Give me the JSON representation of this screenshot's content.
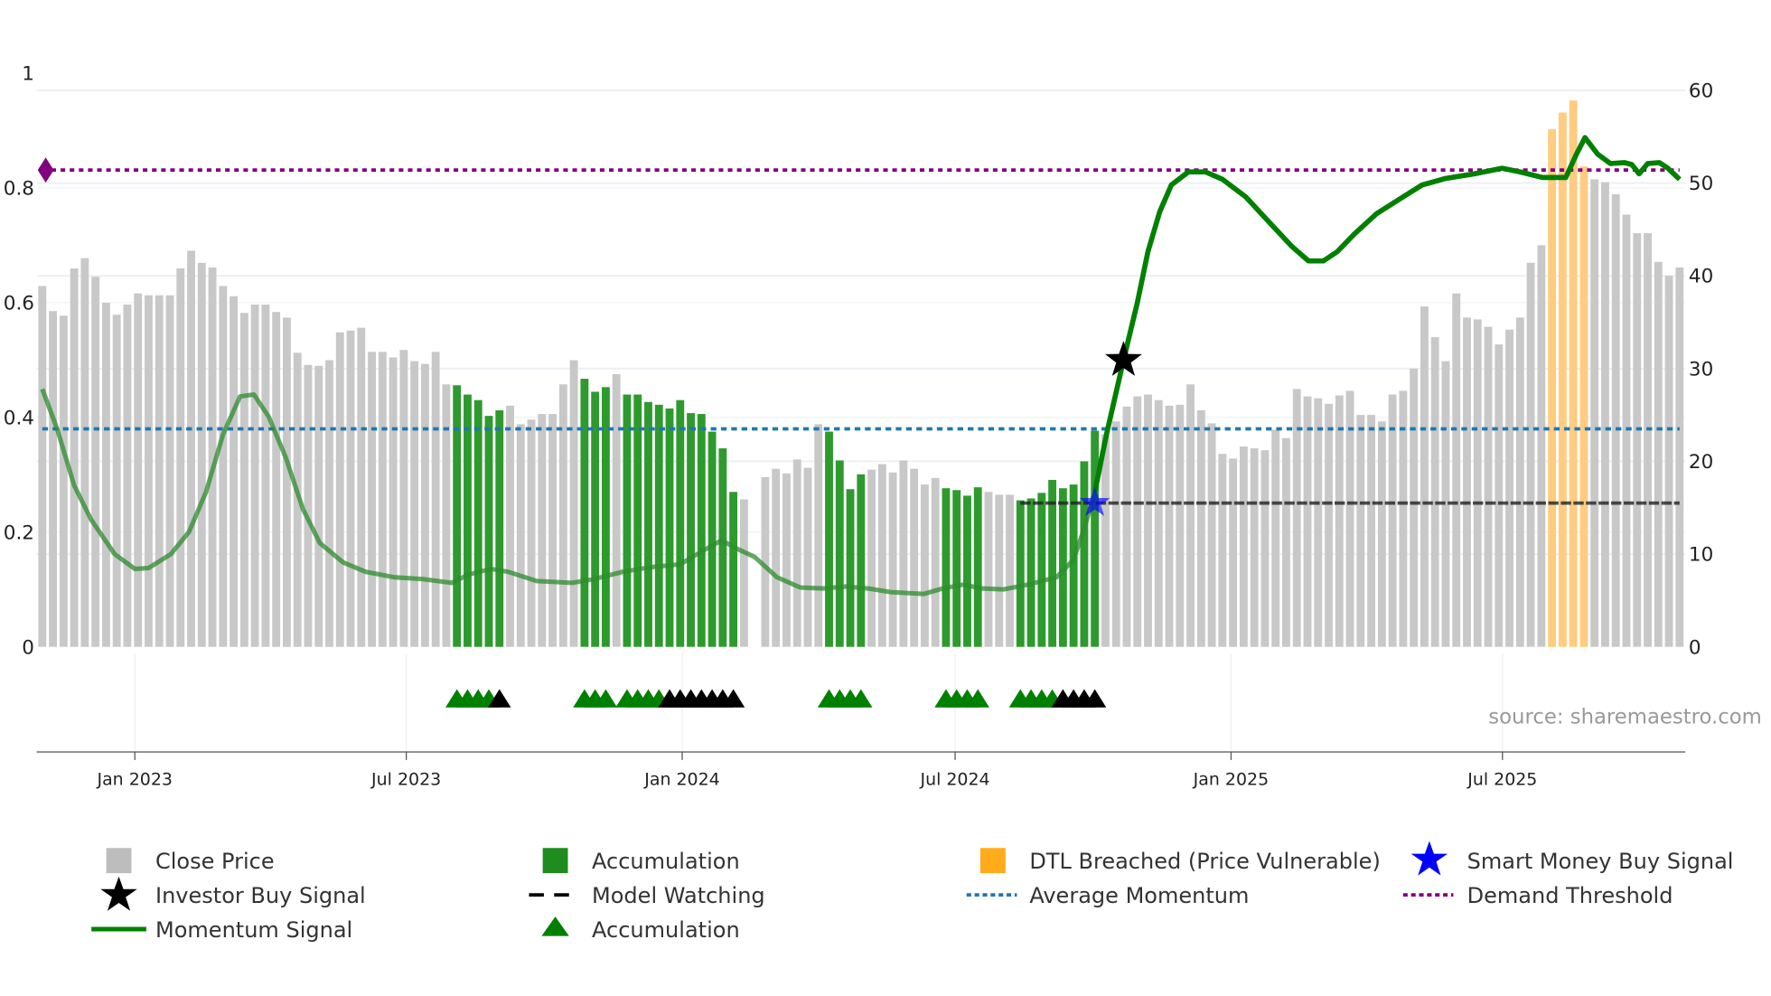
{
  "chart_data": {
    "type": "bar",
    "title": "",
    "x_start": "2022-10-31",
    "interval_days": 7,
    "left_axis": {
      "range": [
        0,
        1
      ],
      "ticks": [
        "0",
        "0.2",
        "0.4",
        "0.6",
        "0.8",
        "1"
      ],
      "values": [
        0,
        0.2,
        0.4,
        0.6,
        0.8,
        1
      ]
    },
    "right_axis": {
      "range": [
        0,
        60
      ],
      "ticks": [
        "0",
        "10",
        "20",
        "30",
        "40",
        "50",
        "60"
      ],
      "values": [
        0,
        10,
        20,
        30,
        40,
        50,
        60
      ]
    },
    "x_ticks": [
      {
        "label": "Jan 2023",
        "date": "2023-01-01"
      },
      {
        "label": "Jul 2023",
        "date": "2023-07-01"
      },
      {
        "label": "Jan 2024",
        "date": "2024-01-01"
      },
      {
        "label": "Jul 2024",
        "date": "2024-07-01"
      },
      {
        "label": "Jan 2025",
        "date": "2025-01-01"
      },
      {
        "label": "Jul 2025",
        "date": "2025-07-01"
      }
    ],
    "close_price": [
      38.9,
      36.2,
      35.7,
      40.8,
      41.9,
      39.9,
      37.1,
      35.8,
      36.9,
      38.1,
      37.9,
      37.9,
      37.9,
      40.8,
      42.7,
      41.4,
      40.9,
      38.9,
      37.8,
      36.0,
      36.9,
      36.9,
      36.1,
      35.5,
      31.7,
      30.4,
      30.3,
      30.9,
      33.9,
      34.1,
      34.4,
      31.8,
      31.8,
      31.2,
      32.0,
      30.8,
      30.5,
      31.8,
      28.3,
      28.2,
      27.2,
      26.6,
      24.9,
      25.5,
      26.0,
      24.0,
      24.5,
      25.1,
      25.1,
      28.3,
      30.9,
      28.9,
      27.5,
      28.0,
      29.4,
      27.2,
      27.2,
      26.4,
      26.1,
      25.7,
      26.6,
      25.2,
      25.1,
      23.2,
      21.4,
      16.7,
      15.9,
      0,
      18.3,
      19.2,
      18.7,
      20.2,
      19.3,
      24.0,
      23.2,
      20.1,
      17.0,
      18.6,
      19.1,
      19.7,
      18.8,
      20.1,
      19.2,
      17.5,
      18.2,
      17.1,
      16.9,
      16.3,
      17.2,
      16.7,
      16.4,
      16.4,
      15.8,
      16.0,
      16.6,
      18.0,
      17.1,
      17.5,
      20.0,
      23.3,
      22.9,
      24.3,
      25.9,
      27.0,
      27.2,
      26.6,
      26.0,
      26.1,
      28.3,
      25.5,
      24.1,
      20.8,
      20.3,
      21.6,
      21.4,
      21.2,
      23.4,
      22.5,
      27.8,
      27.0,
      26.8,
      26.2,
      27.1,
      27.6,
      25.0,
      25.0,
      24.3,
      27.2,
      27.6,
      30.0,
      36.7,
      33.4,
      30.8,
      38.1,
      35.5,
      35.3,
      34.5,
      32.6,
      34.2,
      35.5,
      41.4,
      43.3,
      55.8,
      57.6,
      58.9,
      51.8,
      50.4,
      50.1,
      48.8,
      46.6,
      44.6,
      44.6,
      41.5,
      40.0,
      40.9
    ],
    "accumulation_ranges": [
      [
        39,
        43
      ],
      [
        51,
        53
      ],
      [
        55,
        65
      ],
      [
        74,
        77
      ],
      [
        85,
        88
      ],
      [
        92,
        99
      ]
    ],
    "dtl_breached_ranges": [
      [
        142,
        145
      ]
    ],
    "momentum_signal": [
      [
        0,
        27.8
      ],
      [
        1.4,
        23.5
      ],
      [
        3.0,
        17.4
      ],
      [
        4.6,
        13.7
      ],
      [
        6.8,
        10.0
      ],
      [
        8.7,
        8.4
      ],
      [
        10.0,
        8.5
      ],
      [
        12.1,
        10.0
      ],
      [
        13.8,
        12.4
      ],
      [
        15.4,
        16.7
      ],
      [
        17.0,
        22.9
      ],
      [
        18.6,
        27.0
      ],
      [
        19.9,
        27.2
      ],
      [
        21.3,
        24.8
      ],
      [
        22.9,
        20.4
      ],
      [
        24.5,
        14.9
      ],
      [
        26.1,
        11.2
      ],
      [
        28.3,
        9.1
      ],
      [
        30.4,
        8.1
      ],
      [
        33.1,
        7.5
      ],
      [
        35.8,
        7.3
      ],
      [
        38.5,
        6.9
      ],
      [
        40.1,
        7.8
      ],
      [
        42.2,
        8.4
      ],
      [
        43.8,
        8.1
      ],
      [
        46.5,
        7.1
      ],
      [
        49.8,
        6.9
      ],
      [
        51.9,
        7.3
      ],
      [
        54.6,
        8.1
      ],
      [
        57.3,
        8.6
      ],
      [
        60.0,
        8.9
      ],
      [
        61.6,
        10.0
      ],
      [
        63.9,
        11.5
      ],
      [
        65.3,
        10.6
      ],
      [
        67.0,
        9.7
      ],
      [
        69.1,
        7.5
      ],
      [
        71.3,
        6.4
      ],
      [
        73.4,
        6.3
      ],
      [
        75.6,
        6.5
      ],
      [
        77.7,
        6.3
      ],
      [
        79.8,
        5.9
      ],
      [
        82.9,
        5.7
      ],
      [
        84.7,
        6.3
      ],
      [
        86.6,
        6.7
      ],
      [
        88.4,
        6.3
      ],
      [
        90.4,
        6.2
      ],
      [
        92.7,
        6.7
      ],
      [
        95.4,
        7.5
      ],
      [
        97.0,
        9.4
      ],
      [
        98.1,
        13.1
      ],
      [
        99.0,
        16.7
      ],
      [
        100.1,
        22.9
      ],
      [
        101.7,
        30.9
      ],
      [
        103.0,
        37.1
      ],
      [
        104.0,
        42.6
      ],
      [
        105.1,
        46.9
      ],
      [
        106.2,
        49.8
      ],
      [
        107.8,
        51.2
      ],
      [
        109.4,
        51.2
      ],
      [
        111.0,
        50.4
      ],
      [
        113.2,
        48.5
      ],
      [
        115.3,
        45.9
      ],
      [
        117.5,
        43.2
      ],
      [
        119.1,
        41.6
      ],
      [
        120.5,
        41.6
      ],
      [
        121.8,
        42.6
      ],
      [
        123.4,
        44.5
      ],
      [
        125.5,
        46.7
      ],
      [
        127.7,
        48.3
      ],
      [
        129.8,
        49.8
      ],
      [
        132.0,
        50.5
      ],
      [
        134.7,
        51.0
      ],
      [
        137.3,
        51.6
      ],
      [
        139.0,
        51.2
      ],
      [
        141.1,
        50.6
      ],
      [
        143.3,
        50.6
      ],
      [
        144.3,
        53.1
      ],
      [
        145.1,
        54.9
      ],
      [
        146.3,
        53.1
      ],
      [
        147.5,
        52.1
      ],
      [
        148.8,
        52.2
      ],
      [
        149.5,
        52.0
      ],
      [
        150.2,
        51.0
      ],
      [
        151.0,
        52.1
      ],
      [
        152.1,
        52.2
      ],
      [
        152.9,
        51.6
      ],
      [
        154.0,
        50.4
      ]
    ],
    "momentum_faded_until_week": 99,
    "average_momentum": 23.5,
    "demand_threshold": 51.4,
    "model_watching": {
      "value": 15.5,
      "from_week": 92,
      "to_week": 154
    },
    "investor_buy_signal": {
      "week": 101.7,
      "value": 30.9
    },
    "smart_money_buy_signal": {
      "week": 99,
      "value": 15.5
    },
    "accumulation_triangles": {
      "green": [
        39,
        40,
        41,
        42,
        51,
        52,
        53,
        55,
        56,
        57,
        58,
        74,
        75,
        76,
        77,
        85,
        86,
        87,
        88,
        92,
        93,
        94,
        95
      ],
      "black": [
        43,
        59,
        60,
        61,
        62,
        63,
        64,
        65,
        96,
        97,
        98,
        99
      ]
    },
    "colors": {
      "close": "#c8c8c8",
      "accumulation": "#2e9a2e",
      "dtl": "#ffcc80",
      "dtl_legend": "#ffab1a",
      "momentum": "#008000",
      "average": "#1f77b4",
      "demand": "#800080",
      "model": "#222222",
      "smart_money": "#0000ff"
    },
    "source": "source: sharemaestro.com"
  },
  "legend": [
    {
      "label": "Close Price",
      "icon": "grey-square"
    },
    {
      "label": "Accumulation",
      "icon": "green-square"
    },
    {
      "label": "DTL Breached (Price Vulnerable)",
      "icon": "orange-square"
    },
    {
      "label": "Smart Money Buy Signal",
      "icon": "blue-star"
    },
    {
      "label": "Investor Buy Signal",
      "icon": "black-star"
    },
    {
      "label": "Model Watching",
      "icon": "black-dash"
    },
    {
      "label": "Average Momentum",
      "icon": "blue-dots"
    },
    {
      "label": "Demand Threshold",
      "icon": "purple-dots"
    },
    {
      "label": "Momentum Signal",
      "icon": "green-line"
    },
    {
      "label": "Accumulation",
      "icon": "green-triangle"
    }
  ]
}
